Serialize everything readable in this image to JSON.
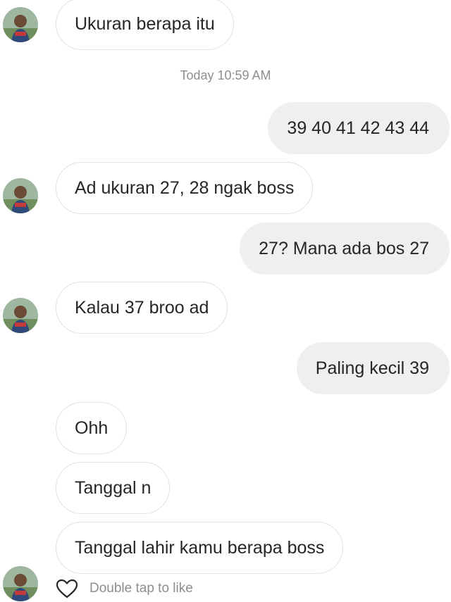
{
  "conversation": {
    "timestamp": "Today 10:59 AM",
    "messages": [
      {
        "direction": "in",
        "text": "Ukuran berapa itu"
      },
      {
        "direction": "out",
        "text": "39 40 41 42 43 44"
      },
      {
        "direction": "in",
        "text": "Ad ukuran 27, 28 ngak boss"
      },
      {
        "direction": "out",
        "text": "27? Mana ada bos 27"
      },
      {
        "direction": "in",
        "text": "Kalau 37 broo ad"
      },
      {
        "direction": "out",
        "text": "Paling kecil 39"
      },
      {
        "direction": "in",
        "text": "Ohh"
      },
      {
        "direction": "in",
        "text": "Tanggal n"
      },
      {
        "direction": "in",
        "text": "Tanggal lahir kamu berapa boss"
      }
    ],
    "like_hint": "Double tap to like",
    "like_icon": "heart-outline-icon"
  },
  "colors": {
    "incoming_bubble_bg": "#ffffff",
    "incoming_bubble_border": "#e1e1e1",
    "outgoing_bubble_bg": "#efefef",
    "meta_text": "#8e8e8e",
    "message_text": "#262626"
  }
}
